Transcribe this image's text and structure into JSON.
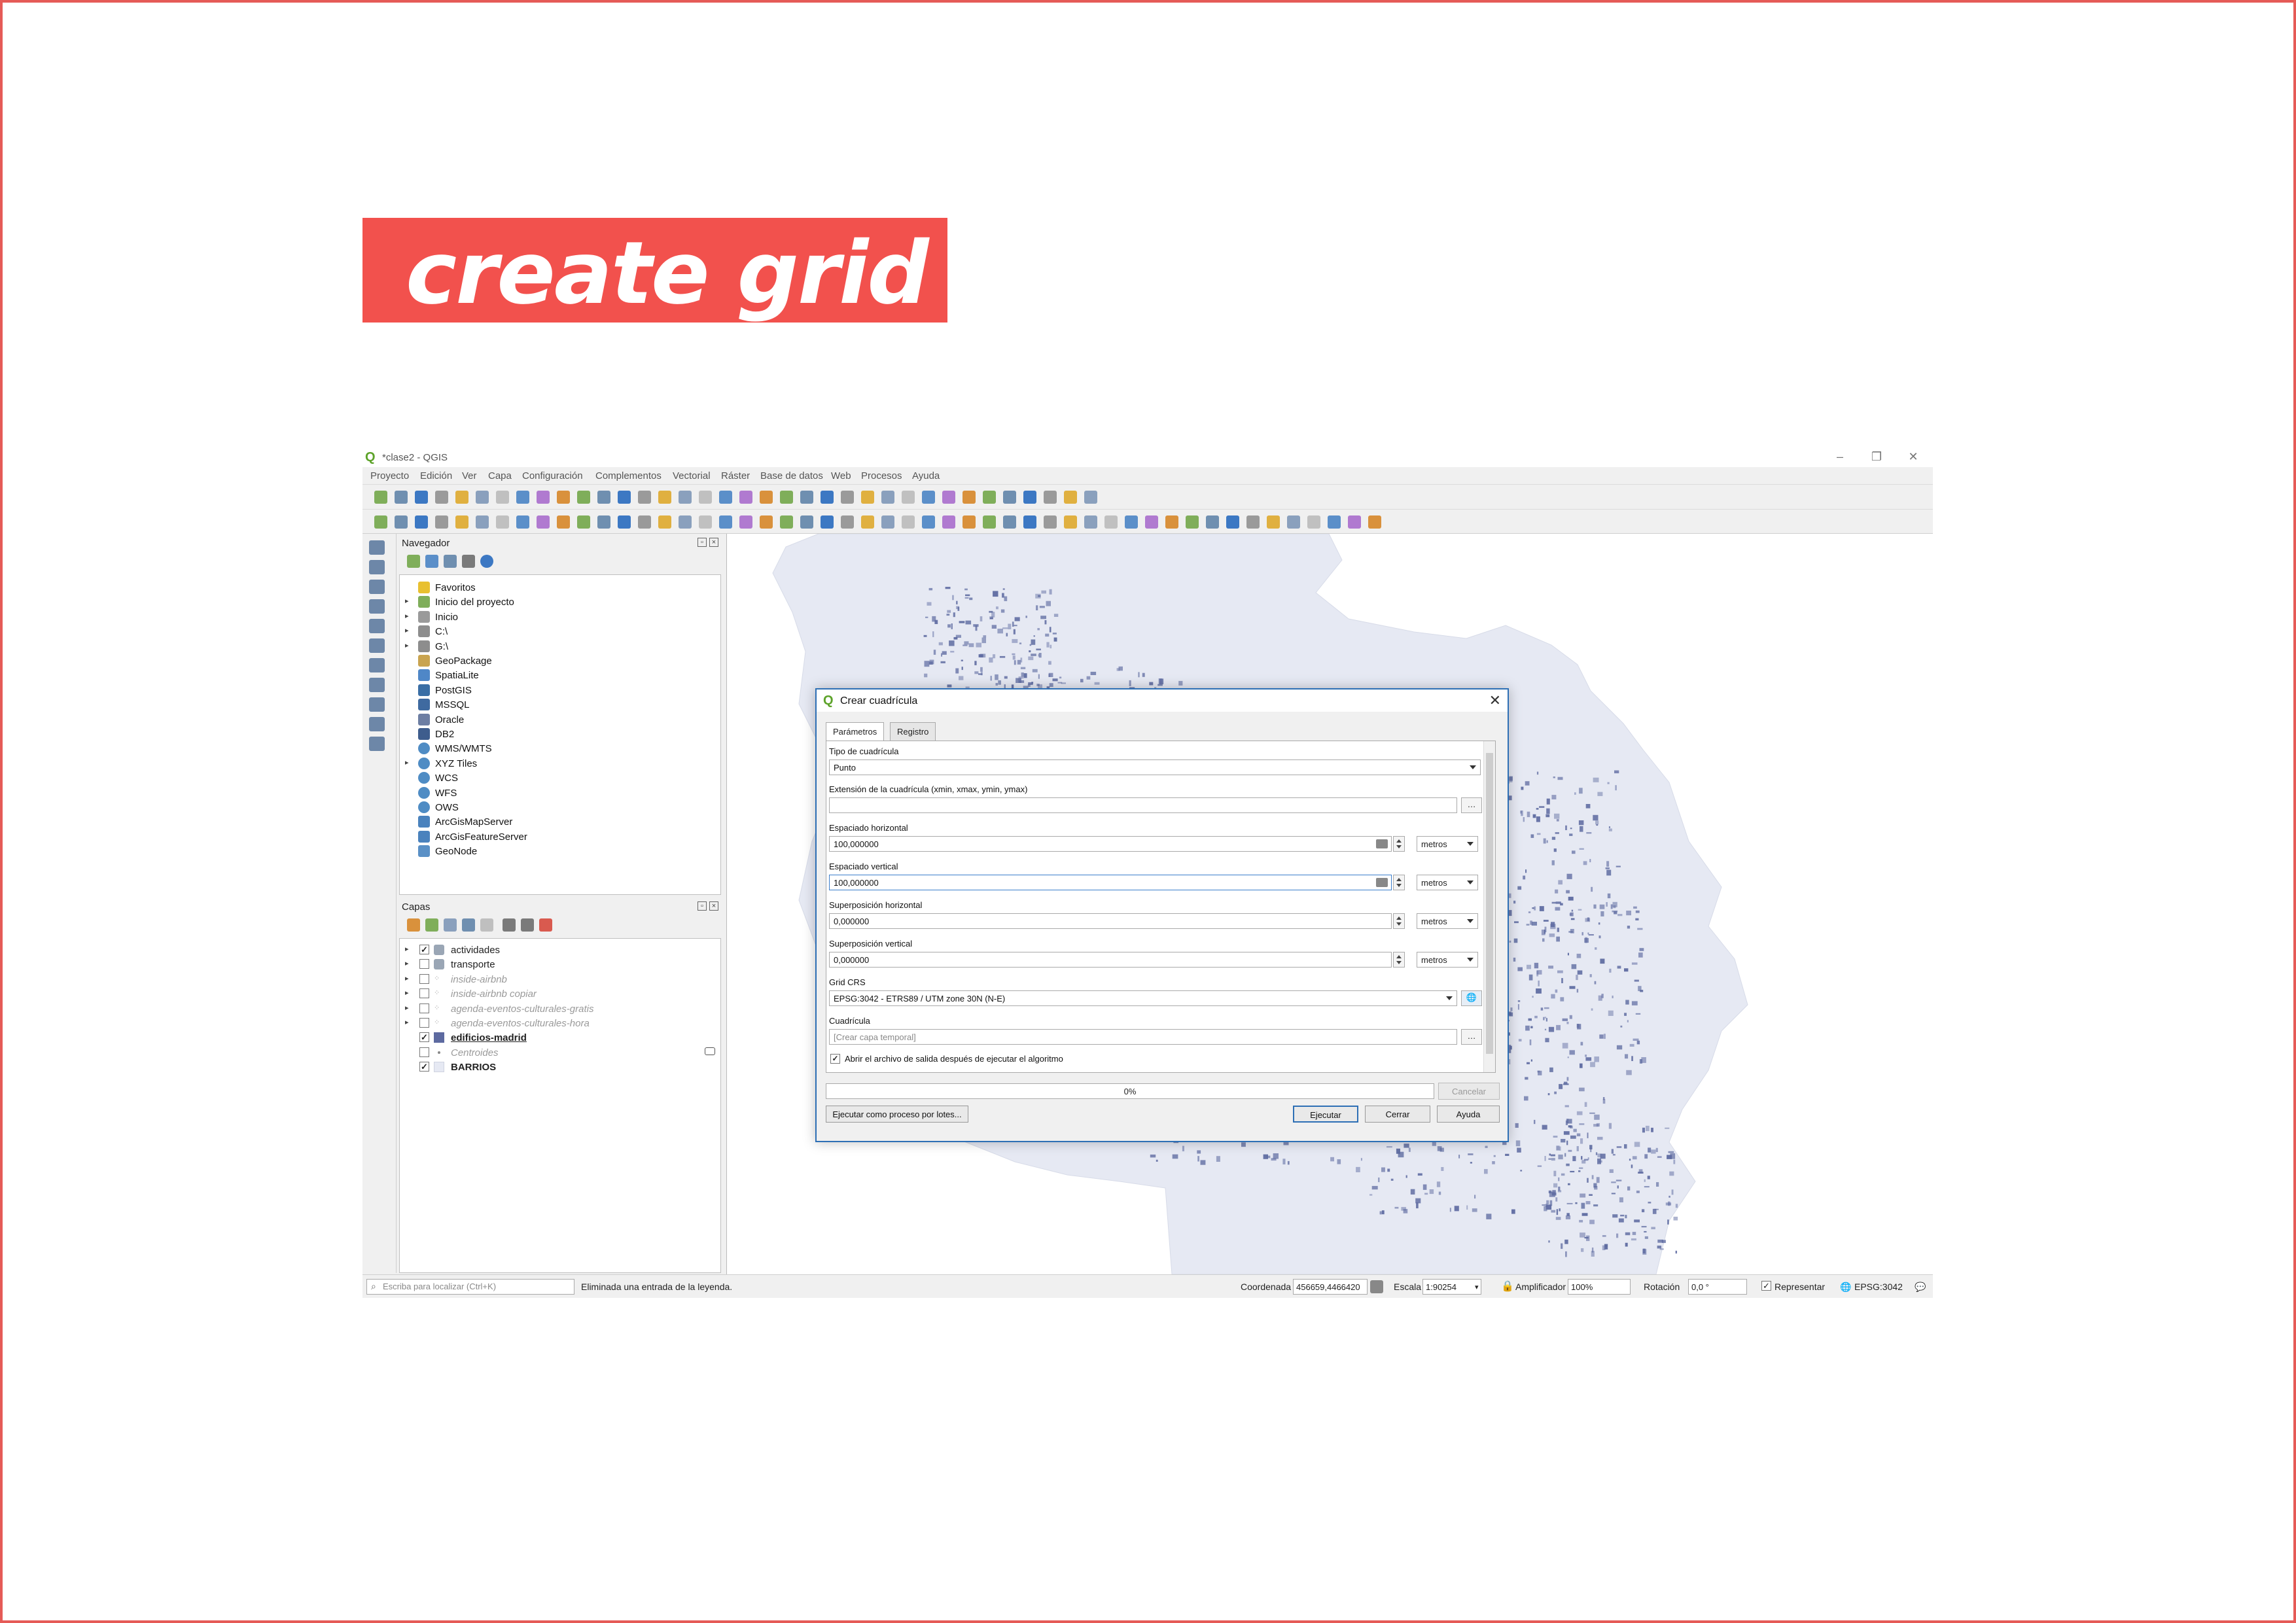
{
  "slide": {
    "title": "create grid",
    "accent_color": "#f2514d",
    "frame_color": "#e55b57"
  },
  "window": {
    "title": "*clase2 - QGIS",
    "controls": [
      "–",
      "❐",
      "✕"
    ]
  },
  "menubar": [
    "Proyecto",
    "Edición",
    "Ver",
    "Capa",
    "Configuración",
    "Complementos",
    "Vectorial",
    "Ráster",
    "Base de datos",
    "Web",
    "Procesos",
    "Ayuda"
  ],
  "navigator": {
    "title": "Navegador",
    "items": [
      {
        "label": "Favoritos",
        "icon": "star-icon",
        "expandable": false
      },
      {
        "label": "Inicio del proyecto",
        "icon": "project-home-icon",
        "expandable": true
      },
      {
        "label": "Inicio",
        "icon": "home-folder-icon",
        "expandable": true
      },
      {
        "label": "C:\\",
        "icon": "drive-icon",
        "expandable": true
      },
      {
        "label": "G:\\",
        "icon": "drive-icon",
        "expandable": true
      },
      {
        "label": "GeoPackage",
        "icon": "geopackage-icon",
        "expandable": false
      },
      {
        "label": "SpatiaLite",
        "icon": "spatialite-icon",
        "expandable": false
      },
      {
        "label": "PostGIS",
        "icon": "postgis-icon",
        "expandable": false
      },
      {
        "label": "MSSQL",
        "icon": "mssql-icon",
        "expandable": false
      },
      {
        "label": "Oracle",
        "icon": "oracle-icon",
        "expandable": false
      },
      {
        "label": "DB2",
        "icon": "db2-icon",
        "expandable": false
      },
      {
        "label": "WMS/WMTS",
        "icon": "globe-icon",
        "expandable": false
      },
      {
        "label": "XYZ Tiles",
        "icon": "globe-icon",
        "expandable": true
      },
      {
        "label": "WCS",
        "icon": "globe-icon",
        "expandable": false
      },
      {
        "label": "WFS",
        "icon": "globe-icon",
        "expandable": false
      },
      {
        "label": "OWS",
        "icon": "globe-icon",
        "expandable": false
      },
      {
        "label": "ArcGisMapServer",
        "icon": "arcgis-icon",
        "expandable": false
      },
      {
        "label": "ArcGisFeatureServer",
        "icon": "arcgis-icon",
        "expandable": false
      },
      {
        "label": "GeoNode",
        "icon": "geonode-icon",
        "expandable": false
      }
    ]
  },
  "layers": {
    "title": "Capas",
    "items": [
      {
        "label": "actividades",
        "checked": true,
        "style": "normal",
        "expandable": true,
        "icon": "layer-group-icon"
      },
      {
        "label": "transporte",
        "checked": false,
        "style": "normal",
        "expandable": true,
        "icon": "layer-group-icon"
      },
      {
        "label": "inside-airbnb",
        "checked": false,
        "style": "gray",
        "expandable": true,
        "icon": "point-layer-icon"
      },
      {
        "label": "inside-airbnb copiar",
        "checked": false,
        "style": "gray",
        "expandable": true,
        "icon": "point-layer-icon"
      },
      {
        "label": "agenda-eventos-culturales-gratis",
        "checked": false,
        "style": "gray",
        "expandable": true,
        "icon": "point-layer-icon"
      },
      {
        "label": "agenda-eventos-culturales-hora",
        "checked": false,
        "style": "gray",
        "expandable": true,
        "icon": "point-layer-icon"
      },
      {
        "label": "edificios-madrid",
        "checked": true,
        "style": "bold-underline",
        "expandable": false,
        "icon": "polygon-swatch-icon"
      },
      {
        "label": "Centroides",
        "checked": false,
        "style": "gray",
        "expandable": false,
        "icon": "point-dot-icon"
      },
      {
        "label": "BARRIOS",
        "checked": true,
        "style": "bold",
        "expandable": false,
        "icon": "polygon-swatch-light-icon"
      }
    ]
  },
  "statusbar": {
    "search_placeholder": "Escriba para localizar (Ctrl+K)",
    "message": "Eliminada una entrada de la leyenda.",
    "coord_label": "Coordenada",
    "coord_value": "456659,4466420",
    "scale_label": "Escala",
    "scale_value": "1:90254",
    "magnifier_label": "Amplificador",
    "magnifier_value": "100%",
    "rotation_label": "Rotación",
    "rotation_value": "0,0 °",
    "render_label": "Representar",
    "render_checked": true,
    "crs": "EPSG:3042"
  },
  "dialog": {
    "title": "Crear cuadrícula",
    "tabs": [
      "Parámetros",
      "Registro"
    ],
    "fields": {
      "grid_type_label": "Tipo de cuadrícula",
      "grid_type_value": "Punto",
      "extent_label": "Extensión de la cuadrícula (xmin, xmax, ymin, ymax)",
      "extent_value": "",
      "hspacing_label": "Espaciado horizontal",
      "hspacing_value": "100,000000",
      "hspacing_units": "metros",
      "vspacing_label": "Espaciado vertical",
      "vspacing_value": "100,000000",
      "vspacing_units": "metros",
      "hoverlay_label": "Superposición horizontal",
      "hoverlay_value": "0,000000",
      "hoverlay_units": "metros",
      "voverlay_label": "Superposición vertical",
      "voverlay_value": "0,000000",
      "voverlay_units": "metros",
      "crs_label": "Grid CRS",
      "crs_value": "EPSG:3042 - ETRS89 / UTM zone 30N (N-E)",
      "output_label": "Cuadrícula",
      "output_placeholder": "[Crear capa temporal]",
      "open_output_label": "Abrir el archivo de salida después de ejecutar el algoritmo",
      "open_output_checked": true
    },
    "progress_percent": 0,
    "progress_text": "0%",
    "buttons": {
      "cancel": "Cancelar",
      "batch": "Ejecutar como proceso por lotes...",
      "run": "Ejecutar",
      "close": "Cerrar",
      "help": "Ayuda"
    }
  },
  "colors": {
    "map_fill": "#e6e9f3",
    "building": "#5d6aa0",
    "qgis_green": "#5da32a",
    "dialog_border": "#2d6fb5"
  }
}
